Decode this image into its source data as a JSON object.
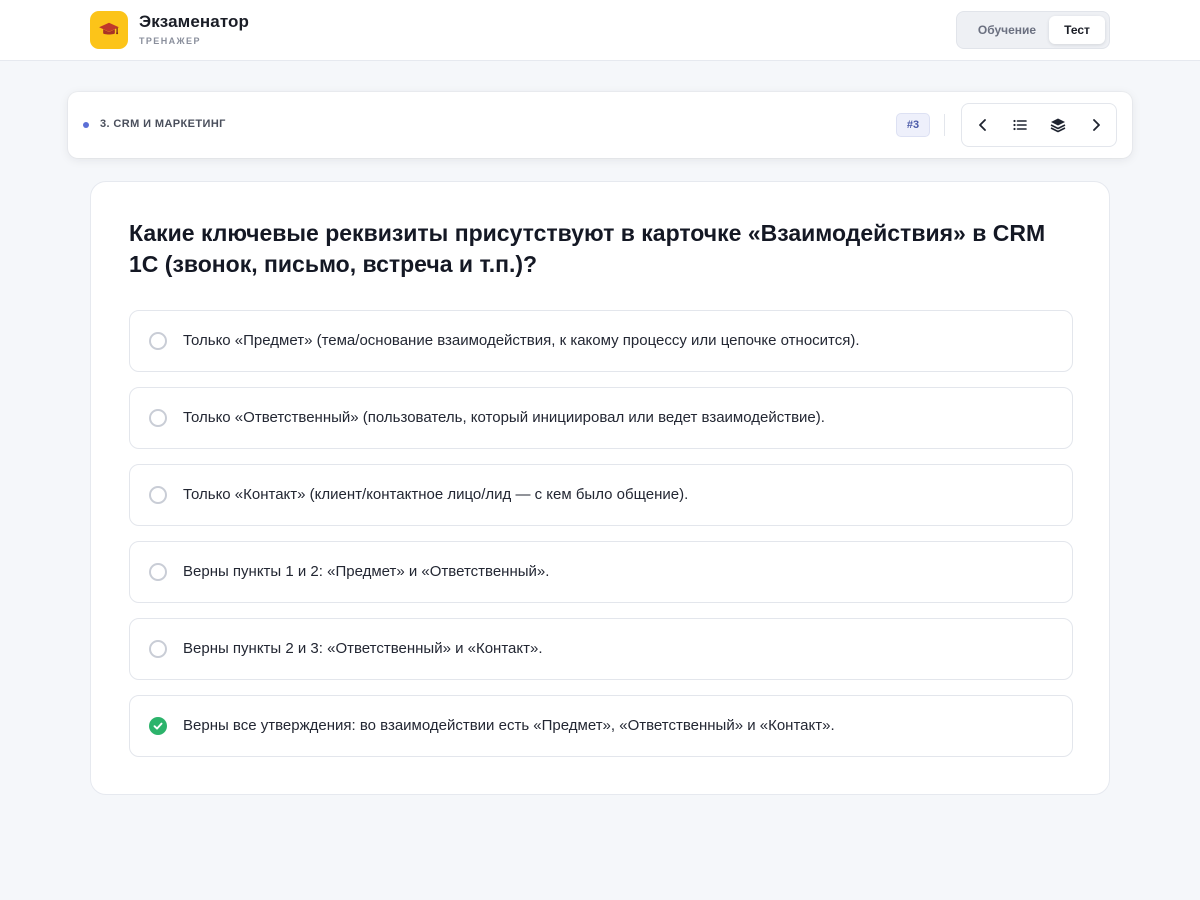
{
  "app": {
    "title": "Экзаменатор",
    "subtitle": "ТРЕНАЖЕР",
    "logo_icon": "graduation-cap-icon",
    "accent": "#fcc419"
  },
  "mode_switch": {
    "learn_label": "Обучение",
    "test_label": "Тест",
    "active": "Тест"
  },
  "topic": {
    "label": "3. CRM И МАРКЕТИНГ",
    "question_number": "#3"
  },
  "nav": {
    "icons": [
      "chevron-left-icon",
      "list-icon",
      "layers-icon",
      "chevron-right-icon"
    ]
  },
  "question": {
    "text": "Какие ключевые реквизиты присутствуют в карточке «Взаимодействия» в CRM 1С (звонок, письмо, встреча и т.п.)?",
    "options": [
      {
        "text": "Только «Предмет» (тема/основание взаимодействия, к какому процессу или цепочке относится).",
        "selected": false
      },
      {
        "text": "Только «Ответственный» (пользователь, который инициировал или ведет взаимодействие).",
        "selected": false
      },
      {
        "text": "Только «Контакт» (клиент/контактное лицо/лид — с кем было общение).",
        "selected": false
      },
      {
        "text": "Верны пункты 1 и 2: «Предмет» и «Ответственный».",
        "selected": false
      },
      {
        "text": "Верны пункты 2 и 3: «Ответственный» и «Контакт».",
        "selected": false
      },
      {
        "text": "Верны все утверждения: во взаимодействии есть «Предмет», «Ответственный» и «Контакт».",
        "selected": true
      }
    ]
  },
  "colors": {
    "selected": "#2cb36b",
    "topic_dot": "#5b6fd6"
  }
}
